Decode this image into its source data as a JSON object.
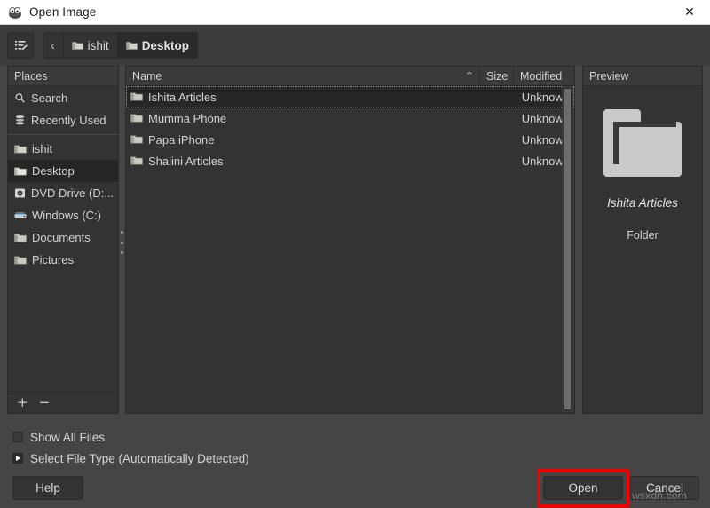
{
  "window": {
    "title": "Open Image",
    "app_icon": "gimp-wilber-icon",
    "close_label": "✕"
  },
  "toolbar": {
    "location_button_icon": "type-location-icon",
    "back_label": "‹",
    "breadcrumbs": [
      {
        "label": "ishit",
        "icon": "folder-icon",
        "active": false
      },
      {
        "label": "Desktop",
        "icon": "folder-icon",
        "active": true
      }
    ]
  },
  "places": {
    "header": "Places",
    "items": [
      {
        "label": "Search",
        "icon": "search-icon",
        "selected": false
      },
      {
        "label": "Recently Used",
        "icon": "recent-icon",
        "selected": false
      },
      {
        "label": "ishit",
        "icon": "folder-icon",
        "selected": false
      },
      {
        "label": "Desktop",
        "icon": "folder-icon",
        "selected": true
      },
      {
        "label": "DVD Drive (D:...",
        "icon": "disc-icon",
        "selected": false
      },
      {
        "label": "Windows (C:)",
        "icon": "drive-icon",
        "selected": false
      },
      {
        "label": "Documents",
        "icon": "folder-icon",
        "selected": false
      },
      {
        "label": "Pictures",
        "icon": "folder-icon",
        "selected": false
      }
    ],
    "add_label": "+",
    "remove_label": "−"
  },
  "filelist": {
    "columns": [
      "Name",
      "Size",
      "Modified"
    ],
    "sort_indicator": "^",
    "rows": [
      {
        "name": "Ishita Articles",
        "size": "",
        "modified": "Unknown",
        "icon": "folder-icon",
        "selected": true
      },
      {
        "name": "Mumma Phone",
        "size": "",
        "modified": "Unknown",
        "icon": "folder-icon",
        "selected": false
      },
      {
        "name": "Papa iPhone",
        "size": "",
        "modified": "Unknown",
        "icon": "folder-icon",
        "selected": false
      },
      {
        "name": "Shalini Articles",
        "size": "",
        "modified": "Unknown",
        "icon": "folder-icon",
        "selected": false
      }
    ]
  },
  "preview": {
    "header": "Preview",
    "icon": "large-folder-icon",
    "name": "Ishita Articles",
    "type": "Folder"
  },
  "options": {
    "show_all_files": {
      "label": "Show All Files",
      "checked": false
    },
    "select_file_type": {
      "label": "Select File Type (Automatically Detected)",
      "expanded": false
    }
  },
  "footer": {
    "help_label": "Help",
    "open_label": "Open",
    "cancel_label": "Cancel",
    "highlight_color": "#f30000"
  },
  "watermark": "wsxdn.com"
}
